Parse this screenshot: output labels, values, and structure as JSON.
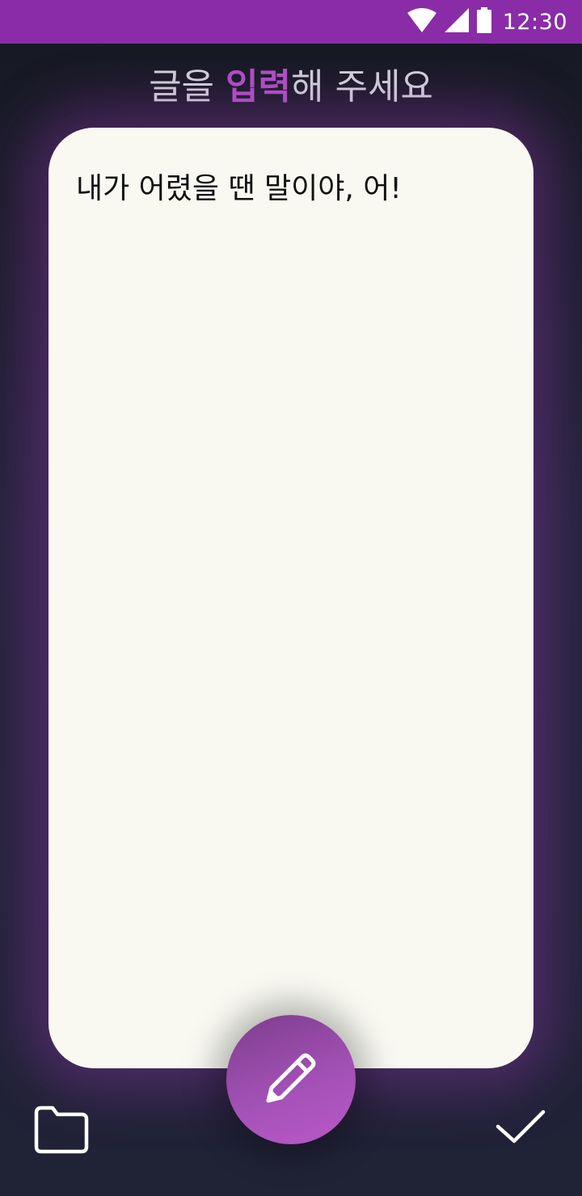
{
  "status_bar": {
    "time": "12:30",
    "icons": [
      "wifi-icon",
      "cellular-signal-icon",
      "battery-icon"
    ],
    "background_color": "#8a2ca8"
  },
  "header": {
    "title_part1": "글을 ",
    "title_accent": "입력",
    "title_part2": "해 주세요",
    "accent_color": "#b04fc4"
  },
  "editor": {
    "text": "내가 어렸을 땐 말이야, 어!"
  },
  "toolbar": {
    "left_icon": "folder-icon",
    "center_icon": "pencil-icon",
    "right_icon": "checkmark-icon"
  }
}
